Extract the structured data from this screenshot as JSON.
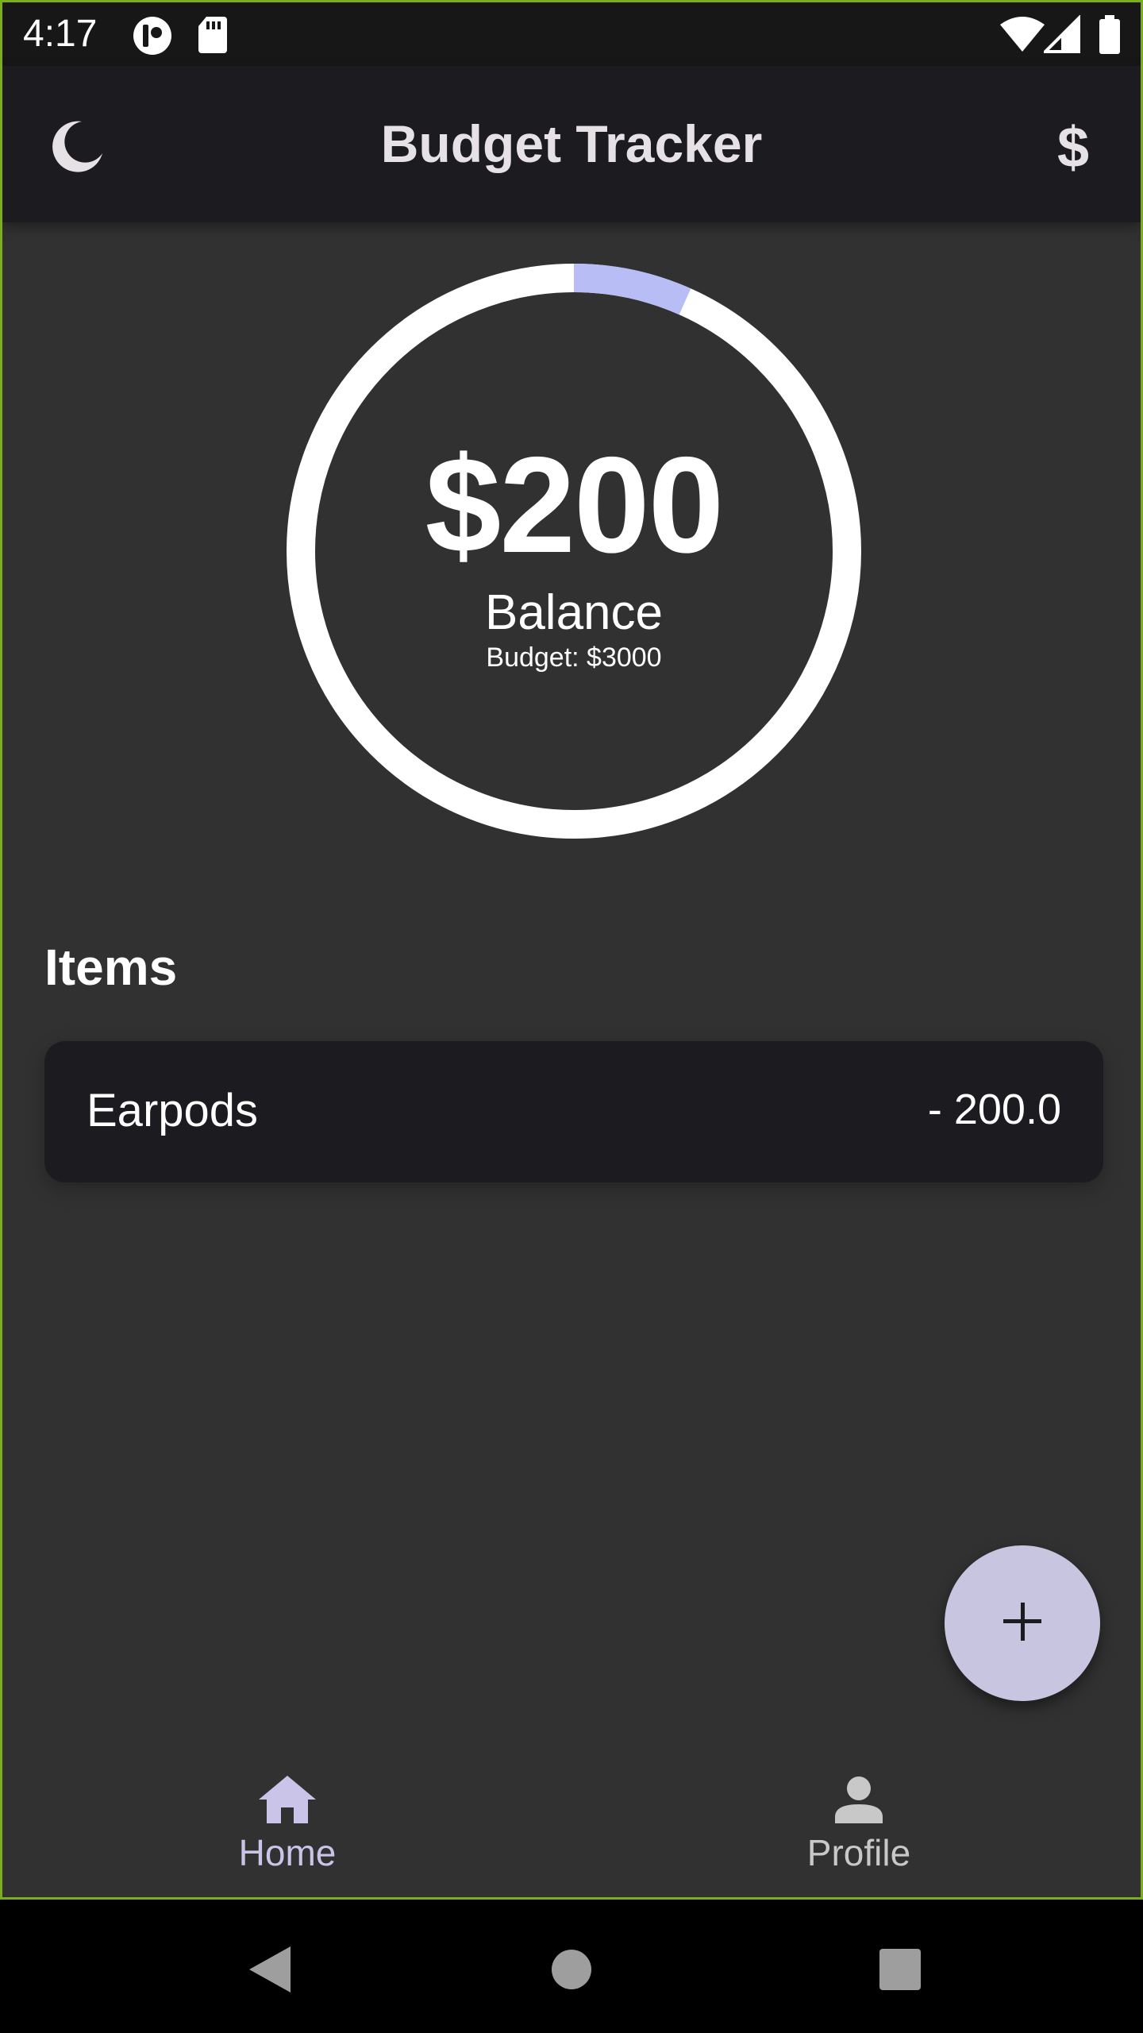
{
  "status_bar": {
    "time": "4:17",
    "left_icons": [
      "media-icon",
      "sd-card-icon"
    ],
    "right_icons": [
      "wifi-icon",
      "signal-icon",
      "battery-icon"
    ]
  },
  "app_bar": {
    "title": "Budget Tracker",
    "theme_icon": "moon-icon",
    "currency_symbol": "$"
  },
  "summary": {
    "balance_amount": "$200",
    "balance_label": "Balance",
    "budget_text": "Budget: $3000",
    "spent_fraction": 0.0667,
    "ring_color": "#ffffff",
    "progress_color": "#b8bdf5"
  },
  "items_section": {
    "heading": "Items",
    "items": [
      {
        "name": "Earpods",
        "amount": "- 200.0"
      }
    ]
  },
  "fab": {
    "icon": "plus-icon",
    "color": "#c8c5e0"
  },
  "bottom_nav": {
    "items": [
      {
        "label": "Home",
        "icon": "home-icon",
        "active": true
      },
      {
        "label": "Profile",
        "icon": "person-icon",
        "active": false
      }
    ]
  },
  "system_nav": {
    "buttons": [
      "back-icon",
      "home-circle-icon",
      "recents-icon"
    ]
  },
  "colors": {
    "background": "#313131",
    "app_bar": "#1c1b1f",
    "accent": "#b8bdf5",
    "frame_border": "#7cad1b"
  }
}
